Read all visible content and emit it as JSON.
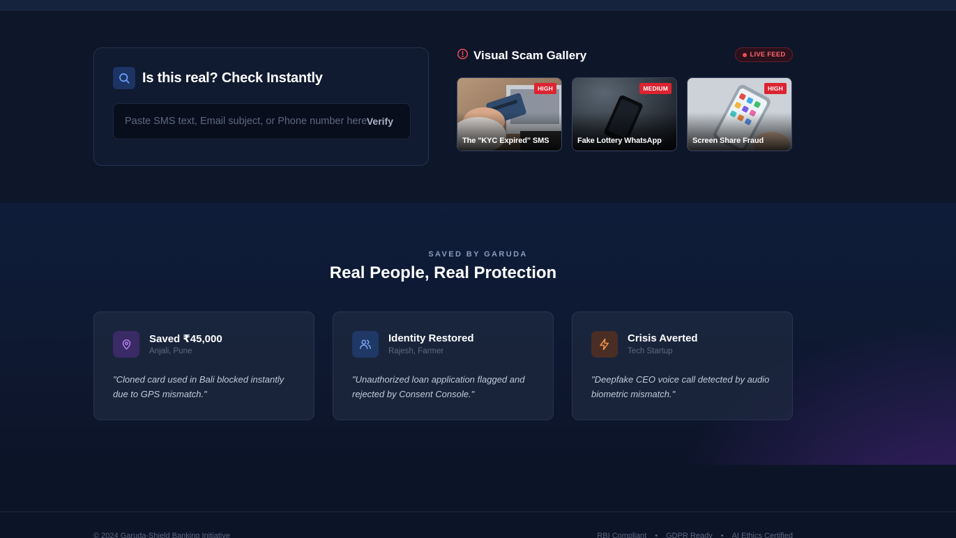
{
  "checker": {
    "title": "Is this real? Check Instantly",
    "placeholder": "Paste SMS text, Email subject, or Phone number here...",
    "verify_label": "Verify"
  },
  "gallery": {
    "title": "Visual Scam Gallery",
    "live_label": "LIVE FEED",
    "items": [
      {
        "label": "The \"KYC Expired\" SMS",
        "severity": "HIGH"
      },
      {
        "label": "Fake Lottery WhatsApp",
        "severity": "MEDIUM"
      },
      {
        "label": "Screen Share Fraud",
        "severity": "HIGH"
      }
    ]
  },
  "testimonials": {
    "overline": "SAVED BY GARUDA",
    "title": "Real People, Real Protection",
    "items": [
      {
        "title": "Saved ₹45,000",
        "subtitle": "Anjali, Pune",
        "quote": "\"Cloned card used in Bali blocked instantly due to GPS mismatch.\"",
        "icon": "map-pin-icon",
        "color": "#a56ae6"
      },
      {
        "title": "Identity Restored",
        "subtitle": "Rajesh, Farmer",
        "quote": "\"Unauthorized loan application flagged and rejected by Consent Console.\"",
        "icon": "users-icon",
        "color": "#6b9cf0"
      },
      {
        "title": "Crisis Averted",
        "subtitle": "Tech Startup",
        "quote": "\"Deepfake CEO voice call detected by audio biometric mismatch.\"",
        "icon": "lightning-icon",
        "color": "#f08a3c"
      }
    ]
  },
  "footer": {
    "copyright": "© 2024 Garuda-Shield Banking Initiative",
    "links": [
      "RBI Compliant",
      "GDPR Ready",
      "AI Ethics Certified"
    ],
    "separator": "•"
  },
  "colors": {
    "accent_red": "#dc2430",
    "accent_blue": "#1c3463",
    "background": "#0c1428"
  }
}
